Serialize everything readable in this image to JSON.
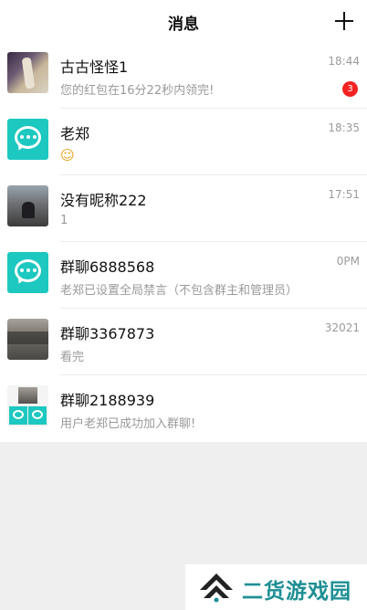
{
  "header": {
    "title": "消息"
  },
  "conversations": [
    {
      "name": "古古怪怪1",
      "preview": "您的红包在16分22秒内领完!",
      "time": "18:44",
      "badge": "3"
    },
    {
      "name": "老郑",
      "preview": "☺",
      "time": "18:35"
    },
    {
      "name": "没有昵称222",
      "preview": "1",
      "time": "17:51"
    },
    {
      "name": "群聊6888568",
      "preview": "老郑已设置全局禁言（不包含群主和管理员）",
      "time": "0PM"
    },
    {
      "name": "群聊3367873",
      "preview": "看完",
      "time": "32021"
    },
    {
      "name": "群聊2188939",
      "preview": "用户老郑已成功加入群聊!",
      "time": ""
    }
  ],
  "watermark": {
    "text": "二货游戏园"
  },
  "colors": {
    "accent_teal": "#1cc8c0",
    "badge_red": "#f42323",
    "watermark_teal": "#1d8f94"
  }
}
